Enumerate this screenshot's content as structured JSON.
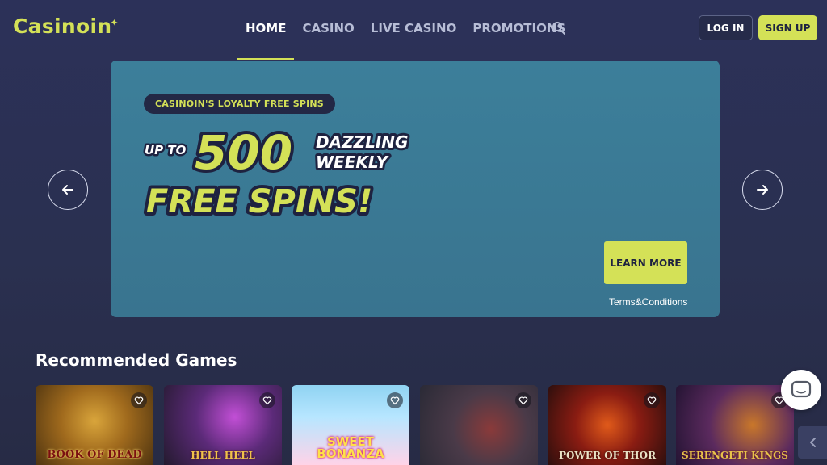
{
  "brand": {
    "name": "Casinoin",
    "color": "#d4e157"
  },
  "nav": {
    "items": [
      {
        "label": "HOME",
        "active": true
      },
      {
        "label": "CASINO",
        "active": false
      },
      {
        "label": "LIVE CASINO",
        "active": false
      },
      {
        "label": "PROMOTIONS",
        "active": false
      }
    ],
    "search_icon": "search-icon"
  },
  "auth": {
    "login_label": "LOG IN",
    "signup_label": "SIGN UP"
  },
  "banner": {
    "pill": "CASINOIN'S LOYALTY FREE SPINS",
    "up_to": "UP TO",
    "amount": "500",
    "line_a": "DAZZLING",
    "line_b": "WEEKLY",
    "line_c": "FREE SPINS!",
    "cta": "LEARN MORE",
    "terms": "Terms&Conditions"
  },
  "carousel": {
    "prev_icon": "arrow-left-icon",
    "next_icon": "arrow-right-icon"
  },
  "section": {
    "title": "Recommended Games"
  },
  "games": [
    {
      "title": "BOOK OF DEAD"
    },
    {
      "title": "HELL HEEL"
    },
    {
      "title": "SWEET BONANZA"
    },
    {
      "title": ""
    },
    {
      "title": "POWER OF THOR"
    },
    {
      "title": "SERENGETI KINGS"
    }
  ],
  "colors": {
    "accent": "#d4e157",
    "background": "#2b3052",
    "banner": "#3c7f9a"
  }
}
